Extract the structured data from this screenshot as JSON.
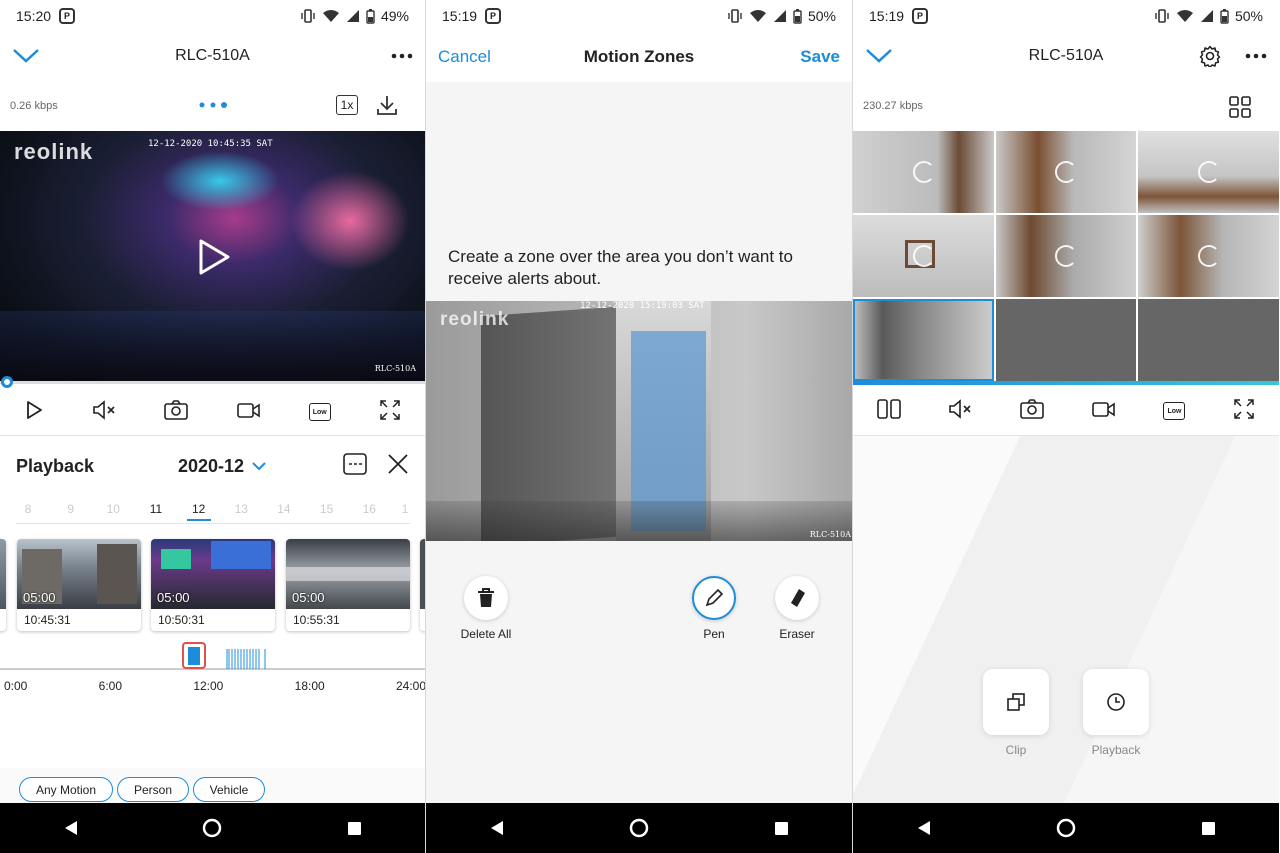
{
  "screen1": {
    "status": {
      "time": "15:20",
      "battery": "49%"
    },
    "title": "RLC-510A",
    "bitrate": "0.26 kbps",
    "speed_label": "1x",
    "video": {
      "logo": "reolink",
      "timestamp": "12-12-2020 10:45:35 SAT",
      "camera_label": "RLC-510A"
    },
    "controls": [
      "play-icon",
      "mute-icon",
      "snapshot-icon",
      "record-icon",
      "quality-low-icon",
      "fullscreen-icon"
    ],
    "quality_label": "Low",
    "playback": {
      "title": "Playback",
      "month": "2020-12",
      "days": [
        "8",
        "9",
        "10",
        "11",
        "12",
        "13",
        "14",
        "15",
        "16",
        "1"
      ],
      "selected_day": "12",
      "clips": [
        {
          "duration": "05:00",
          "time": "10:45:31"
        },
        {
          "duration": "05:00",
          "time": "10:50:31"
        },
        {
          "duration": "05:00",
          "time": "10:55:31"
        }
      ],
      "timeline_labels": [
        "0:00",
        "6:00",
        "12:00",
        "18:00",
        "24:00"
      ],
      "filters": [
        "Any Motion",
        "Person",
        "Vehicle"
      ]
    }
  },
  "screen2": {
    "status": {
      "time": "15:19",
      "battery": "50%"
    },
    "cancel_label": "Cancel",
    "title": "Motion Zones",
    "save_label": "Save",
    "instructions": "Create a zone over the area you don’t want to receive alerts about.",
    "video": {
      "logo": "reolink",
      "timestamp": "12-12-2020 15:19:03 SAT",
      "camera_label": "RLC-510A"
    },
    "tools": {
      "delete_all": "Delete All",
      "pen": "Pen",
      "eraser": "Eraser"
    }
  },
  "screen3": {
    "status": {
      "time": "15:19",
      "battery": "50%"
    },
    "title": "RLC-510A",
    "bitrate": "230.27 kbps",
    "quality_label": "Low",
    "actions": {
      "clip": "Clip",
      "playback": "Playback"
    }
  },
  "colors": {
    "accent": "#1d8cd9",
    "zone": "#5f9ad0",
    "highlight": "#e2504c"
  }
}
